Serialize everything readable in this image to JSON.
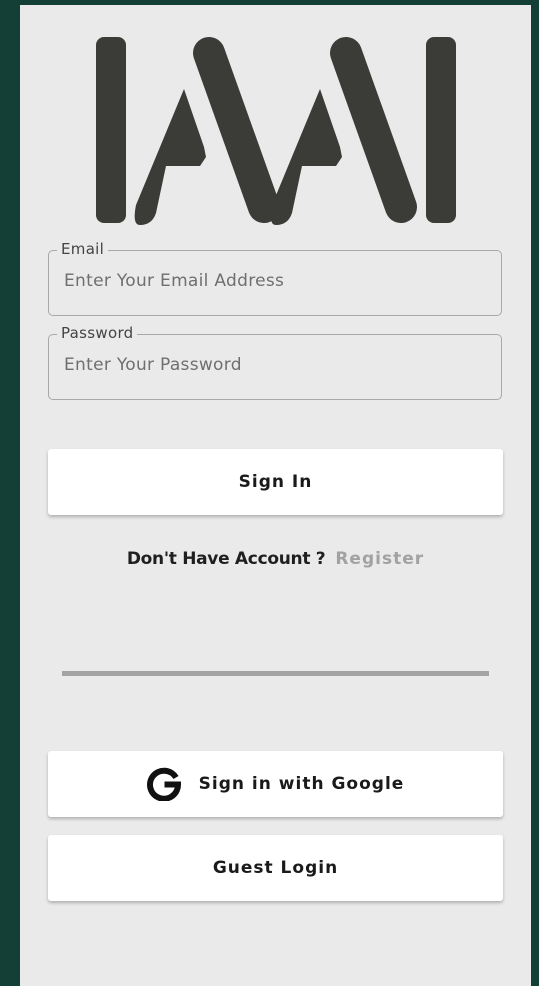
{
  "logo": {
    "name": "IAAI"
  },
  "email": {
    "label": "Email",
    "placeholder": "Enter Your Email Address",
    "value": ""
  },
  "password": {
    "label": "Password",
    "placeholder": "Enter Your Password",
    "value": ""
  },
  "sign_in": {
    "label": "Sign In"
  },
  "register": {
    "question": "Don't Have Account ?",
    "link": "Register"
  },
  "google": {
    "label": "Sign in with Google",
    "icon": "google-g-icon"
  },
  "guest": {
    "label": "Guest Login"
  },
  "colors": {
    "background": "#143f37",
    "panel": "#eaeaea",
    "logo": "#3b3b37",
    "muted_link": "#a2a2a2"
  }
}
